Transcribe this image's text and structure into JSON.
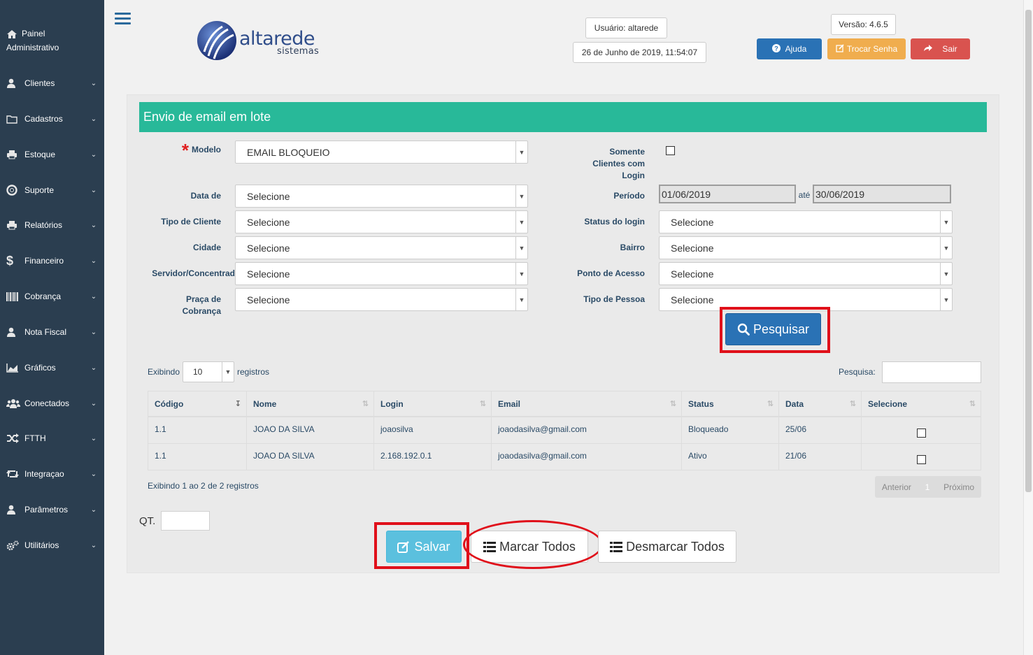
{
  "sidebar": {
    "painel_line1": "Painel",
    "painel_line2": "Administrativo",
    "items": [
      {
        "label": "Clientes",
        "icon": "user-icon"
      },
      {
        "label": "Cadastros",
        "icon": "folder-icon"
      },
      {
        "label": "Estoque",
        "icon": "printer-icon"
      },
      {
        "label": "Suporte",
        "icon": "lifebuoy-icon"
      },
      {
        "label": "Relatórios",
        "icon": "printer-icon"
      },
      {
        "label": "Financeiro",
        "icon": "dollar-icon"
      },
      {
        "label": "Cobrança",
        "icon": "barcode-icon"
      },
      {
        "label": "Nota Fiscal",
        "icon": "user-icon"
      },
      {
        "label": "Gráficos",
        "icon": "area-chart-icon"
      },
      {
        "label": "Conectados",
        "icon": "users-icon"
      },
      {
        "label": "FTTH",
        "icon": "random-icon"
      },
      {
        "label": "Integraçao",
        "icon": "retweet-icon"
      },
      {
        "label": "Parâmetros",
        "icon": "user-icon"
      },
      {
        "label": "Utilitários",
        "icon": "cogs-icon"
      }
    ]
  },
  "header": {
    "logo_brand": "altarede",
    "logo_sub": "sistemas",
    "usuario": "Usuário: altarede",
    "datetime": "26 de Junho de 2019, 11:54:07",
    "versao": "Versão: 4.6.5",
    "ajuda": "Ajuda",
    "trocar_senha": "Trocar Senha",
    "sair": "Sair"
  },
  "form": {
    "title": "Envio de email em lote",
    "modelo_label": "Modelo",
    "modelo_value": "EMAIL BLOQUEIO",
    "somente_line1": "Somente",
    "somente_line2": "Clientes com",
    "somente_line3": "Login",
    "data_de_label": "Data de",
    "data_de_value": "Selecione",
    "periodo_label": "Período",
    "periodo_inicio": "01/06/2019",
    "ate_label": "até",
    "periodo_fim": "30/06/2019",
    "tipo_cliente_label": "Tipo de Cliente",
    "tipo_cliente_value": "Selecione",
    "status_login_label": "Status do login",
    "status_login_value": "Selecione",
    "cidade_label": "Cidade",
    "cidade_value": "Selecione",
    "bairro_label": "Bairro",
    "bairro_value": "Selecione",
    "servidor_label": "Servidor/Concentrad",
    "servidor_value": "Selecione",
    "ponto_label": "Ponto de Acesso",
    "ponto_value": "Selecione",
    "praca_line1": "Praça de",
    "praca_line2": "Cobrança",
    "praca_value": "Selecione",
    "tipo_pessoa_label": "Tipo de Pessoa",
    "tipo_pessoa_value": "Selecione",
    "pesquisar": "Pesquisar"
  },
  "table": {
    "exibindo_label": "Exibindo",
    "page_size": "10",
    "registros_label": "registros",
    "pesquisa_label": "Pesquisa:",
    "columns": [
      "Código",
      "Nome",
      "Login",
      "Email",
      "Status",
      "Data",
      "Selecione"
    ],
    "rows": [
      {
        "codigo": "1.1",
        "nome": "JOAO DA SILVA",
        "login": "joaosilva",
        "email": "joaodasilva@gmail.com",
        "status": "Bloqueado",
        "data": "25/06"
      },
      {
        "codigo": "1.1",
        "nome": "JOAO DA SILVA",
        "login": "2.168.192.0.1",
        "email": "joaodasilva@gmail.com",
        "status": "Ativo",
        "data": "21/06"
      }
    ],
    "info": "Exibindo 1 ao 2 de 2 registros",
    "anterior": "Anterior",
    "page": "1",
    "proximo": "Próximo"
  },
  "footer": {
    "qt_label": "QT.",
    "salvar": "Salvar",
    "marcar_todos": "Marcar Todos",
    "desmarcar_todos": "Desmarcar Todos"
  },
  "colors": {
    "sidebar_bg": "#2b3e50",
    "title_bar": "#28b999",
    "primary": "#2a72b5",
    "ajuda": "#2a72b5",
    "trocar": "#f0ad4e",
    "sair": "#d9534f",
    "salvar": "#5bc0de",
    "highlight": "#e0101a"
  }
}
